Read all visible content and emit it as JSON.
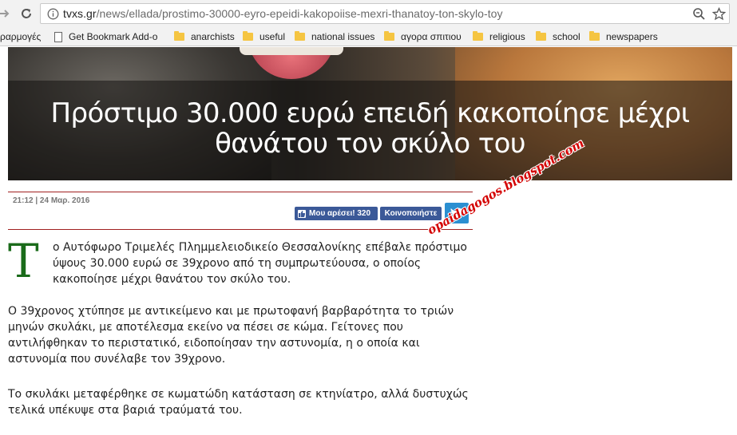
{
  "browser": {
    "url_host": "tvxs.gr",
    "url_path": "/news/ellada/prostimo-30000-eyro-epeidi-kakopoiise-mexri-thanatoy-ton-skylo-toy"
  },
  "bookmarks": [
    {
      "label": "ραρμογές",
      "icon": "apps-icon"
    },
    {
      "label": "Get Bookmark Add-o",
      "icon": "page-icon"
    },
    {
      "label": "anarchists",
      "icon": "folder-icon"
    },
    {
      "label": "useful",
      "icon": "folder-icon"
    },
    {
      "label": "national issues",
      "icon": "folder-icon"
    },
    {
      "label": "αγορα σπιτιου",
      "icon": "folder-icon"
    },
    {
      "label": "religious",
      "icon": "folder-icon"
    },
    {
      "label": "school",
      "icon": "folder-icon"
    },
    {
      "label": "newspapers",
      "icon": "folder-icon"
    }
  ],
  "article": {
    "title": "Πρόστιμο 30.000 ευρώ επειδή κακοποίησε μέχρι θανάτου τον σκύλο του",
    "date": "21:12 | 24 Μαρ. 2016",
    "like_label": "Μου αρέσει! 320",
    "share_label": "Κοινοποιήστε",
    "dropcap": "Τ",
    "p1": "ο Αυτόφωρο Τριμελές Πλημμελειοδικείο Θεσσαλονίκης επέβαλε πρόστιμο ύψους 30.000 ευρώ σε 39χρονο από τη συμπρωτεύουσα, ο οποίος κακοποίησε μέχρι θανάτου τον σκύλο του.",
    "p2": "Ο 39χρονος χτύπησε με αντικείμενο και με πρωτοφανή βαρβαρότητα το τριών μηνών σκυλάκι, με αποτέλεσμα εκείνο να πέσει σε κώμα. Γείτονες που αντιλήφθηκαν το περιστατικό, ειδοποίησαν την αστυνομία, η ο οποία και αστυνομία που συνέλαβε τον 39χρονο.",
    "p3": "Το σκυλάκι μεταφέρθηκε σε κωματώδη κατάσταση σε κτηνίατρο, αλλά δυστυχώς τελικά υπέκυψε στα βαριά τραύματά του."
  },
  "watermark": "opaidagogos.blogspot.com",
  "colors": {
    "facebook": "#3b5998",
    "twitter": "#2b8fd1",
    "rule": "#a02020",
    "dropcap": "#1a6b1a",
    "watermark": "#d40000"
  }
}
